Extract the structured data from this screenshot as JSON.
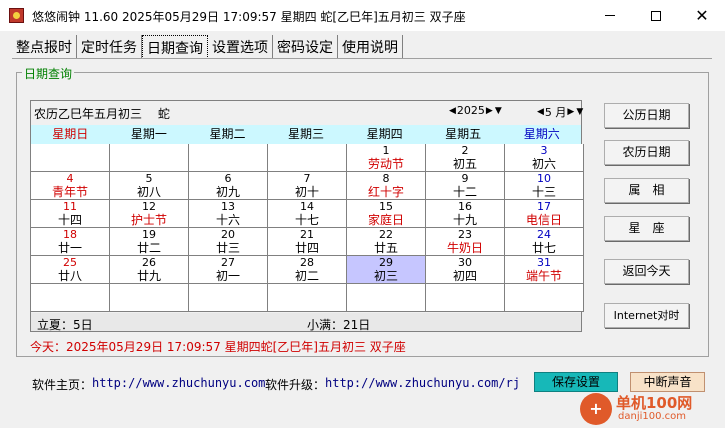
{
  "window": {
    "title": "悠悠闹钟 11.60 2025年05月29日 17:09:57 星期四 蛇[乙巳年]五月初三 双子座",
    "minimize": "—",
    "maximize": "☐",
    "close": "✕"
  },
  "tabs": [
    {
      "label": "整点报时"
    },
    {
      "label": "定时任务"
    },
    {
      "label": "日期查询"
    },
    {
      "label": "设置选项"
    },
    {
      "label": "密码设定"
    },
    {
      "label": "使用说明"
    }
  ],
  "group_label": "日期查询",
  "calendar": {
    "lunar_header": "农历乙巳年五月初三　 蛇",
    "year": "2025",
    "month": "5 月",
    "weekdays": [
      "星期日",
      "星期一",
      "星期二",
      "星期三",
      "星期四",
      "星期五",
      "星期六"
    ],
    "rows": [
      [
        {
          "n": "",
          "l": ""
        },
        {
          "n": "",
          "l": ""
        },
        {
          "n": "",
          "l": ""
        },
        {
          "n": "",
          "l": ""
        },
        {
          "n": "1",
          "l": "劳动节",
          "f": true
        },
        {
          "n": "2",
          "l": "初五"
        },
        {
          "n": "3",
          "l": "初六"
        }
      ],
      [
        {
          "n": "4",
          "l": "青年节",
          "f": true
        },
        {
          "n": "5",
          "l": "初八"
        },
        {
          "n": "6",
          "l": "初九"
        },
        {
          "n": "7",
          "l": "初十"
        },
        {
          "n": "8",
          "l": "红十字",
          "f": true
        },
        {
          "n": "9",
          "l": "十二"
        },
        {
          "n": "10",
          "l": "十三"
        }
      ],
      [
        {
          "n": "11",
          "l": "十四"
        },
        {
          "n": "12",
          "l": "护士节",
          "f": true
        },
        {
          "n": "13",
          "l": "十六"
        },
        {
          "n": "14",
          "l": "十七"
        },
        {
          "n": "15",
          "l": "家庭日",
          "f": true
        },
        {
          "n": "16",
          "l": "十九"
        },
        {
          "n": "17",
          "l": "电信日",
          "f": true
        }
      ],
      [
        {
          "n": "18",
          "l": "廿一"
        },
        {
          "n": "19",
          "l": "廿二"
        },
        {
          "n": "20",
          "l": "廿三"
        },
        {
          "n": "21",
          "l": "廿四"
        },
        {
          "n": "22",
          "l": "廿五"
        },
        {
          "n": "23",
          "l": "牛奶日",
          "f": true
        },
        {
          "n": "24",
          "l": "廿七"
        }
      ],
      [
        {
          "n": "25",
          "l": "廿八"
        },
        {
          "n": "26",
          "l": "廿九"
        },
        {
          "n": "27",
          "l": "初一"
        },
        {
          "n": "28",
          "l": "初二"
        },
        {
          "n": "29",
          "l": "初三",
          "today": true
        },
        {
          "n": "30",
          "l": "初四"
        },
        {
          "n": "31",
          "l": "端午节",
          "f": true
        }
      ],
      [
        {
          "n": "",
          "l": ""
        },
        {
          "n": "",
          "l": ""
        },
        {
          "n": "",
          "l": ""
        },
        {
          "n": "",
          "l": ""
        },
        {
          "n": "",
          "l": ""
        },
        {
          "n": "",
          "l": ""
        },
        {
          "n": "",
          "l": ""
        }
      ]
    ],
    "term_left": "立夏：5日",
    "term_right": "小满：21日"
  },
  "side_buttons": [
    "公历日期",
    "农历日期",
    "属　相",
    "星　座",
    "返回今天",
    "Internet对时"
  ],
  "today_line": "今天：2025年05月29日 17:09:57 星期四蛇[乙巳年]五月初三 双子座",
  "footer": {
    "home_label": "软件主页：",
    "home_url": "http://www.zhuchunyu.com",
    "update_label": "软件升级：",
    "update_url": "http://www.zhuchunyu.com/rj",
    "save_button": "保存设置",
    "stop_button": "中断声音"
  },
  "watermark": {
    "text1": "单机100网",
    "text2": "danji100.com"
  },
  "colors": {
    "accent_red": "#d00000",
    "weekday_bg": "#ccf8ff",
    "today_bg": "#c6c6ff",
    "save_bg": "#17b8b8"
  }
}
